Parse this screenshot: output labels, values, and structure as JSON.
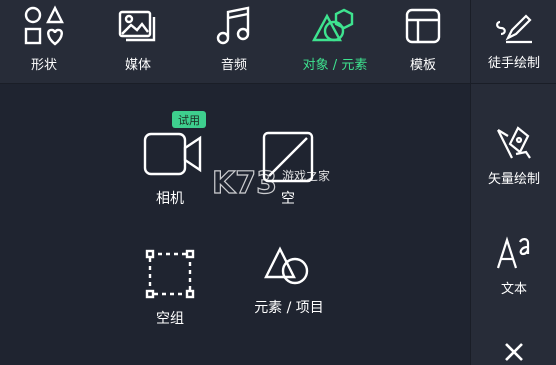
{
  "tabs": [
    {
      "label": "形状",
      "icon": "shapes-icon",
      "active": false
    },
    {
      "label": "媒体",
      "icon": "media-icon",
      "active": false
    },
    {
      "label": "音频",
      "icon": "music-note-icon",
      "active": false
    },
    {
      "label": "对象 / 元素",
      "icon": "objects-elements-icon",
      "active": true
    },
    {
      "label": "模板",
      "icon": "template-icon",
      "active": false
    }
  ],
  "sidebar": {
    "freehand": "徒手绘制",
    "vector": "矢量绘制",
    "text": "文本",
    "close_icon": "close-icon"
  },
  "grid": {
    "camera": "相机",
    "camera_badge": "试用",
    "empty": "空",
    "empty_group": "空组",
    "element_item": "元素 / 项目"
  },
  "watermark": {
    "logo": "K73",
    "text": "游戏之家"
  },
  "colors": {
    "accent": "#3ee38f",
    "background": "#1f2430",
    "panel": "#272c38",
    "badge": "#3ecf8e"
  }
}
